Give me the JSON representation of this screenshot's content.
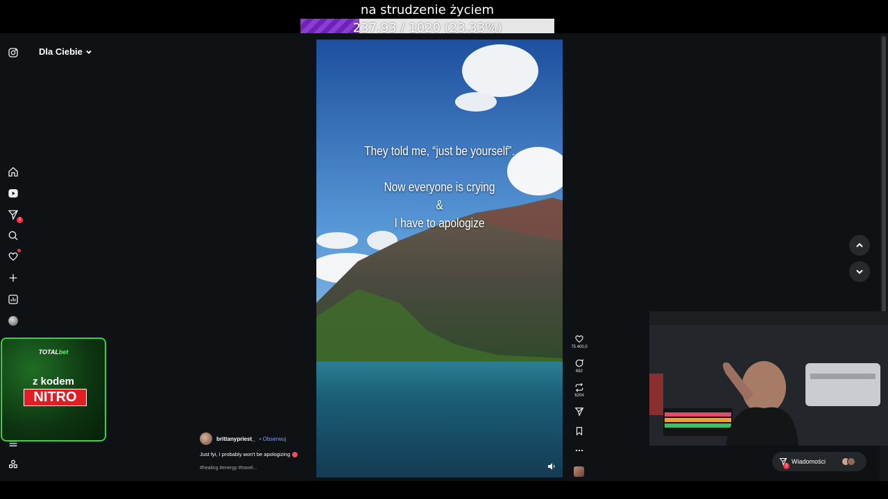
{
  "overlay": {
    "stream_title": "na strudzenie życiem",
    "progress_text": "237.93 / 1020 (23.33%)",
    "progress_fraction": 0.2333,
    "progress_color": "#8a3fd1"
  },
  "sidebar": {
    "feed_selector": "Dla Ciebie",
    "notification_count": "2",
    "icons": [
      "instagram-icon",
      "home-icon",
      "reels-icon",
      "direct-icon",
      "search-icon",
      "heart-icon",
      "create-icon",
      "insights-icon",
      "profile-avatar",
      "menu-icon",
      "threads-icon"
    ]
  },
  "reel": {
    "caption_line1": "They told me, “just be yourself”.",
    "caption_line2": "Now everyone is crying",
    "caption_line3": "&",
    "caption_line4": "I have to apologize",
    "author": "brittanypriest_",
    "follow_label": "• Obserwuj",
    "post_caption": "Just fyi, I probably won't be apologizing",
    "hashtags": "#healing #energy #travel..."
  },
  "actions": {
    "likes": "75 400,0",
    "comments": "662",
    "reposts": "6204"
  },
  "promo": {
    "brand_prefix": "TOTAL",
    "brand_suffix": "bet",
    "line": "z kodem",
    "code": "NITRO"
  },
  "messages": {
    "label": "Wiadomości",
    "badge": "2"
  }
}
